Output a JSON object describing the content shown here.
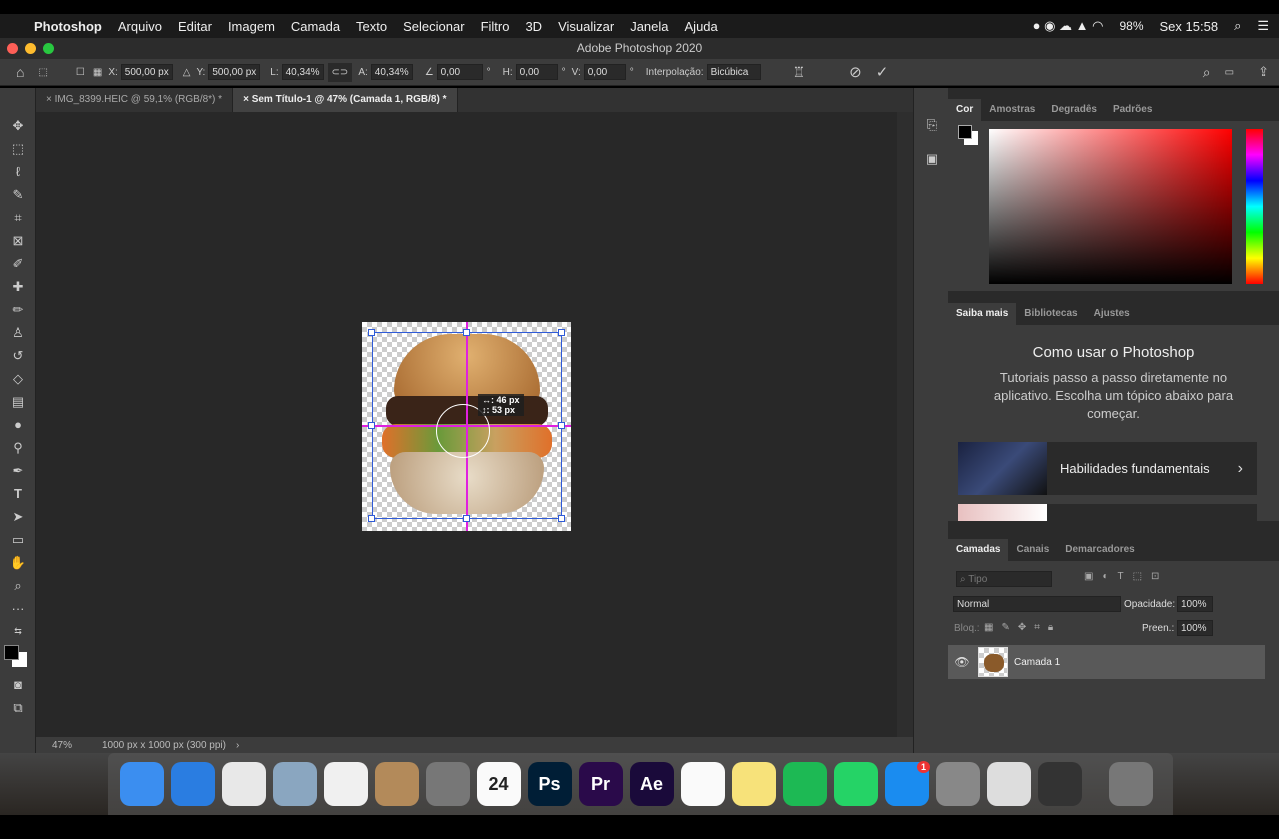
{
  "menubar": {
    "app": "Photoshop",
    "items": [
      "Arquivo",
      "Editar",
      "Imagem",
      "Camada",
      "Texto",
      "Selecionar",
      "Filtro",
      "3D",
      "Visualizar",
      "Janela",
      "Ajuda"
    ],
    "battery": "98%",
    "clock": "Sex 15:58"
  },
  "window": {
    "title": "Adobe Photoshop 2020"
  },
  "options": {
    "x_label": "X:",
    "x": "500,00 px",
    "y_label": "Y:",
    "y": "500,00 px",
    "w_label": "L:",
    "w": "40,34%",
    "h_label": "A:",
    "h": "40,34%",
    "angle": "0,00",
    "deg": "°",
    "hskew_label": "H:",
    "hskew": "0,00",
    "vskew_label": "V:",
    "vskew": "0,00",
    "interp_label": "Interpolação:",
    "interp": "Bicúbica"
  },
  "tabs": [
    {
      "label": "IMG_8399.HEIC @ 59,1% (RGB/8*) *",
      "active": false
    },
    {
      "label": "Sem Título-1 @ 47% (Camada 1, RGB/8) *",
      "active": true
    }
  ],
  "canvas": {
    "tooltip_w": "↔: 46 px",
    "tooltip_h": "↕: 53 px"
  },
  "status": {
    "zoom": "47%",
    "doc": "1000 px x 1000 px (300 ppi)"
  },
  "color_panel": {
    "tabs": [
      "Cor",
      "Amostras",
      "Degradês",
      "Padrões"
    ],
    "hue": "#ff0000"
  },
  "learn_panel": {
    "tabs": [
      "Saiba mais",
      "Bibliotecas",
      "Ajustes"
    ],
    "title": "Como usar o Photoshop",
    "text": "Tutoriais passo a passo diretamente no aplicativo. Escolha um tópico abaixo para começar.",
    "card": "Habilidades fundamentais"
  },
  "layers_panel": {
    "tabs": [
      "Camadas",
      "Canais",
      "Demarcadores"
    ],
    "filter_placeholder": "Tipo",
    "blend": "Normal",
    "opacity_label": "Opacidade:",
    "opacity": "100%",
    "lock_label": "Bloq.:",
    "fill_label": "Preen.:",
    "fill": "100%",
    "layers": [
      {
        "name": "Camada 1",
        "visible": true
      }
    ]
  },
  "dock": {
    "apps": [
      {
        "name": "finder",
        "color": "#3b8ef0",
        "label": ""
      },
      {
        "name": "safari",
        "color": "#2a7de1",
        "label": ""
      },
      {
        "name": "chrome",
        "color": "#e8e8e8",
        "label": ""
      },
      {
        "name": "preview",
        "color": "#8aa6c0",
        "label": ""
      },
      {
        "name": "photos",
        "color": "#f0f0f0",
        "label": ""
      },
      {
        "name": "contacts",
        "color": "#b38a5a",
        "label": ""
      },
      {
        "name": "calculator",
        "color": "#777",
        "label": ""
      },
      {
        "name": "calendar",
        "color": "#fafafa",
        "label": "24"
      },
      {
        "name": "photoshop",
        "color": "#001e36",
        "label": "Ps"
      },
      {
        "name": "premiere",
        "color": "#2a0a4a",
        "label": "Pr"
      },
      {
        "name": "after-effects",
        "color": "#1a0a3a",
        "label": "Ae"
      },
      {
        "name": "reminders",
        "color": "#fafafa",
        "label": ""
      },
      {
        "name": "notes",
        "color": "#f7e27a",
        "label": ""
      },
      {
        "name": "spotify",
        "color": "#1db954",
        "label": ""
      },
      {
        "name": "whatsapp",
        "color": "#25d366",
        "label": ""
      },
      {
        "name": "app-store",
        "color": "#1a8cf0",
        "label": "1"
      },
      {
        "name": "system-preferences",
        "color": "#888",
        "label": ""
      },
      {
        "name": "roblox",
        "color": "#ddd",
        "label": ""
      },
      {
        "name": "quicktime",
        "color": "#333",
        "label": ""
      },
      {
        "name": "trash",
        "color": "#777",
        "label": ""
      }
    ]
  }
}
